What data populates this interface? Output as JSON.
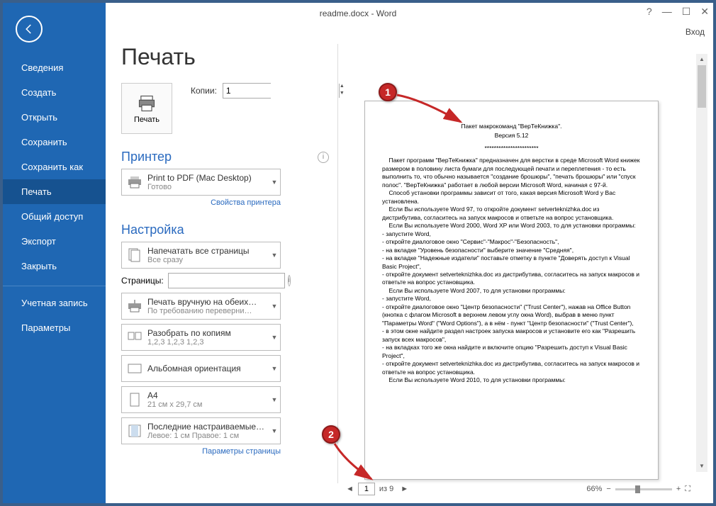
{
  "window": {
    "title": "readme.docx - Word",
    "login": "Вход"
  },
  "sidebar": {
    "items": [
      {
        "label": "Сведения"
      },
      {
        "label": "Создать"
      },
      {
        "label": "Открыть"
      },
      {
        "label": "Сохранить"
      },
      {
        "label": "Сохранить как"
      },
      {
        "label": "Печать"
      },
      {
        "label": "Общий доступ"
      },
      {
        "label": "Экспорт"
      },
      {
        "label": "Закрыть"
      },
      {
        "label": "Учетная запись"
      },
      {
        "label": "Параметры"
      }
    ],
    "active_index": 5,
    "sep_index": 9
  },
  "main": {
    "header": "Печать",
    "print_button": "Печать",
    "copies_label": "Копии:",
    "copies_value": "1",
    "printer_header": "Принтер",
    "printer_combo": {
      "l1": "Print to PDF (Mac Desktop)",
      "l2": "Готово"
    },
    "printer_props": "Свойства принтера",
    "settings_header": "Настройка",
    "combos": [
      {
        "key": "allpages",
        "l1": "Напечатать все страницы",
        "l2": "Все сразу"
      },
      {
        "key": "manual",
        "l1": "Печать вручную на обеих…",
        "l2": "По требованию переверни…"
      },
      {
        "key": "collate",
        "l1": "Разобрать по копиям",
        "l2": "1,2,3   1,2,3   1,2,3"
      },
      {
        "key": "orient",
        "l1": "Альбомная ориентация",
        "l2": ""
      },
      {
        "key": "paper",
        "l1": "A4",
        "l2": "21 см x 29,7 см"
      },
      {
        "key": "margins",
        "l1": "Последние настраиваемые…",
        "l2": "Левое: 1 см   Правое: 1 см"
      }
    ],
    "pages_label": "Страницы:",
    "page_params": "Параметры страницы"
  },
  "preview": {
    "lines": [
      "Пакет макрокоманд \"ВерТеКнижка\".",
      "Версия 5.12",
      "***********************"
    ],
    "body": "    Пакет программ \"ВерТеКнижка\" предназначен для верстки в среде Microsoft Word книжек размером в половину листа бумаги для последующей печати и переплетения - то есть выполнить то, что обычно называется \"создание брошюры\", \"печать брошюры\" или \"спуск полос\". \"ВерТеКнижка\" работает в любой версии Microsoft Word, начиная с 97-й.\n    Способ установки программы зависит от того, какая версия Microsoft Word у Вас установлена.\n    Если Вы используете Word 97, то откройте документ setverteknizhka.doc из дистрибутива, согласитесь на запуск макросов и ответьте на вопрос установщика.\n    Если Вы используете Word 2000, Word XP или Word 2003, то для установки программы:\n- запустите Word,\n- откройте диалоговое окно \"Сервис\"-\"Макрос\"-\"Безопасность\",\n- на вкладке \"Уровень безопасности\" выберите значение \"Средняя\",\n- на вкладке \"Надежные издатели\" поставьте отметку в пункте \"Доверять доступ к Visual Basic Project\",\n- откройте документ setverteknizhka.doc из дистрибутива, согласитесь на запуск макросов и ответьте на вопрос установщика.\n    Если Вы используете Word 2007, то для установки программы:\n- запустите Word,\n- откройте диалоговое окно \"Центр безопасности\" (\"Trust Center\"), нажав на Office Button (кнопка с флагом Microsoft в верхнем левом углу окна Word), выбрав в меню пункт \"Параметры Word\" (\"Word Options\"), а в нём - пункт \"Центр безопасности\" (\"Trust Center\"),\n- в этом окне найдите раздел настроек запуска макросов и установите его как \"Разрешить запуск всех макросов\",\n- на вкладках того же окна найдите и включите опцию \"Разрешить доступ к Visual Basic Project\",\n- откройте документ setverteknizhka.doc из дистрибутива, согласитесь на запуск макросов и ответьте на вопрос установщика.\n    Если Вы используете Word 2010, то для установки программы:"
  },
  "bottombar": {
    "page_current": "1",
    "page_total_label": "из 9",
    "zoom": "66%"
  },
  "callouts": {
    "c1": "1",
    "c2": "2"
  }
}
